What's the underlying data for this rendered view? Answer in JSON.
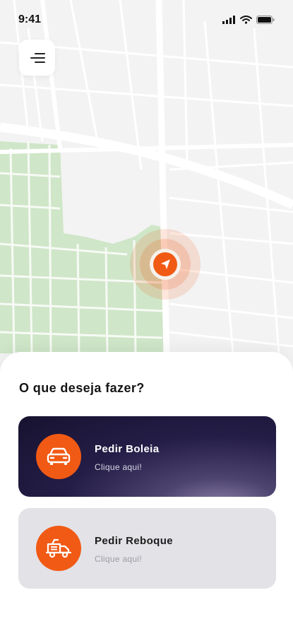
{
  "status_bar": {
    "time": "9:41",
    "icons": [
      "signal-icon",
      "wifi-icon",
      "battery-icon"
    ]
  },
  "menu_button": {
    "icon": "menu-icon"
  },
  "map": {
    "location_marker_icon": "navigation-arrow-icon",
    "colors": {
      "background": "#f3f3f3",
      "park": "#cfe6c8",
      "road": "#ffffff",
      "accent": "#f15a14"
    }
  },
  "sheet": {
    "title": "O que deseja fazer?",
    "options": [
      {
        "title": "Pedir Boleia",
        "subtitle": "Clique aqui!",
        "icon": "car-icon"
      },
      {
        "title": "Pedir Reboque",
        "subtitle": "Clique aqui!",
        "icon": "tow-truck-icon"
      }
    ]
  }
}
